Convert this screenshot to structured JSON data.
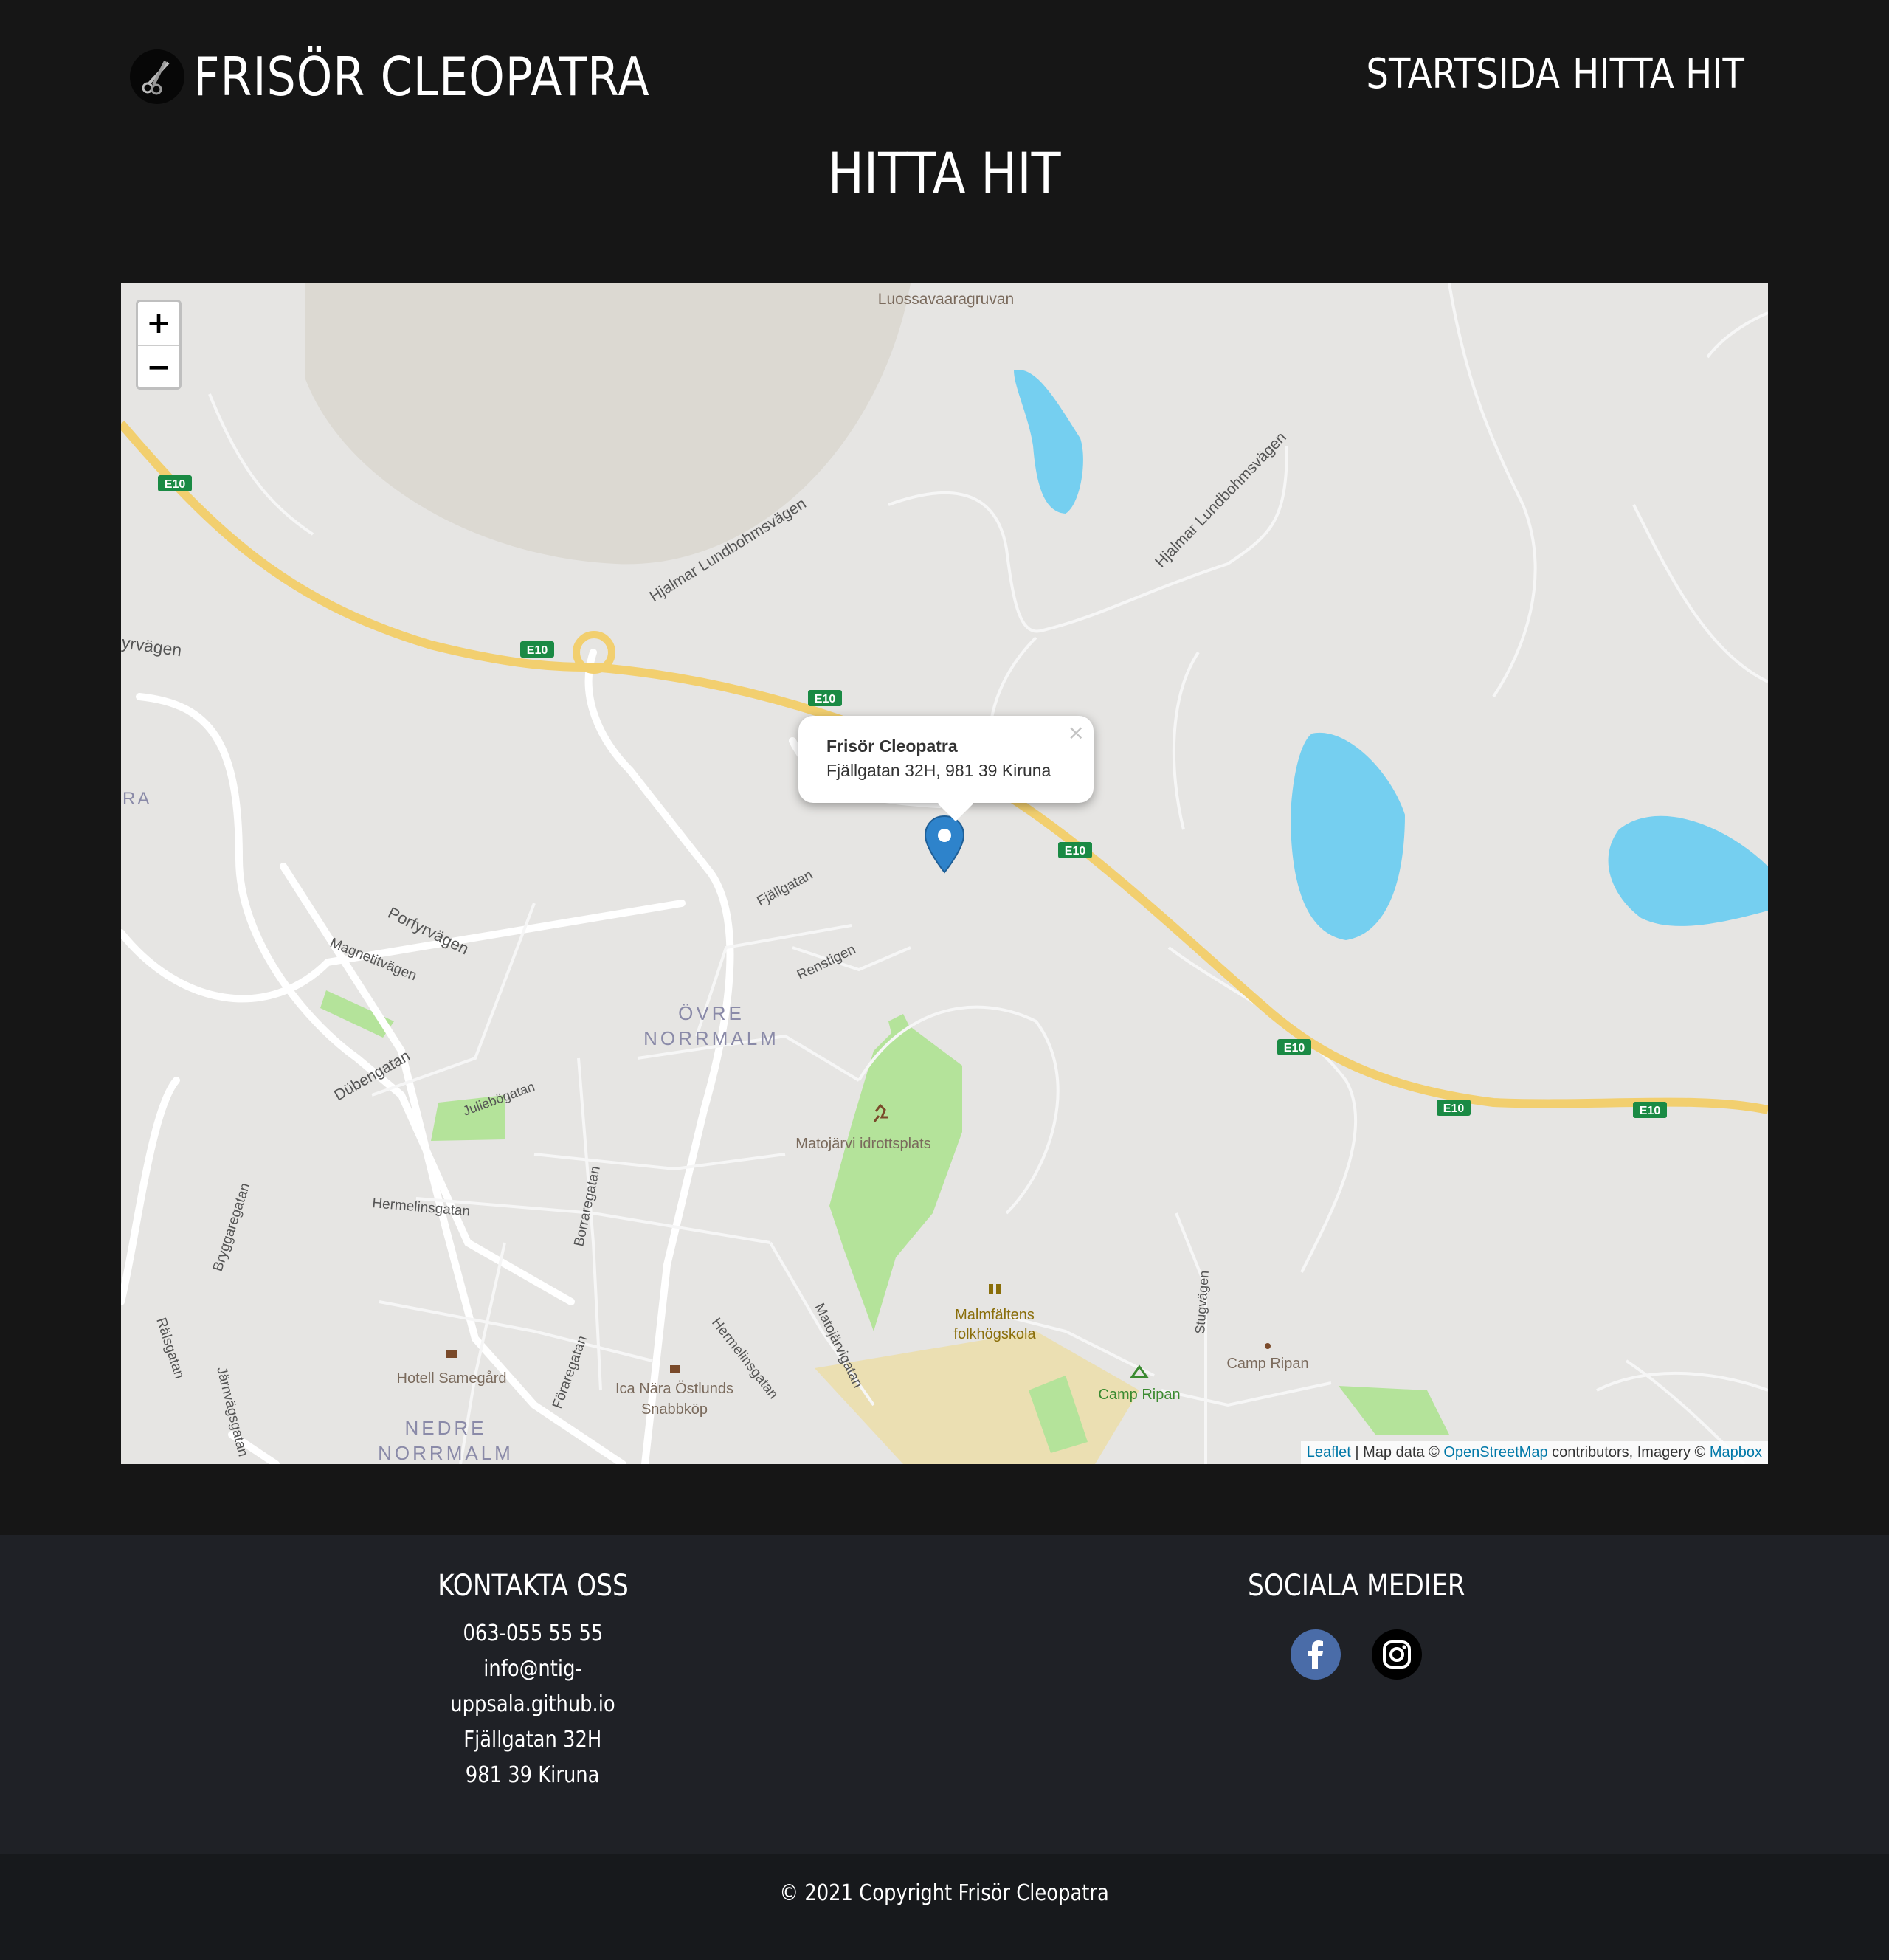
{
  "header": {
    "brand": "FRISÖR CLEOPATRA",
    "nav": [
      "STARTSIDA",
      "HITTA HIT"
    ]
  },
  "page_title": "HITTA HIT",
  "map": {
    "zoom_in": "+",
    "zoom_out": "−",
    "popup": {
      "title": "Frisör Cleopatra",
      "address": "Fjällgatan 32H, 981 39 Kiruna",
      "close": "×"
    },
    "labels": {
      "luossa": "Luossavaaragruvan",
      "hjalmar1": "Hjalmar Lundbohmsvägen",
      "hjalmar2": "Hjalmar Lundbohmsvägen",
      "e10": "E10",
      "yrvagen": "yrvägen",
      "ra": "RA",
      "porfyr": "Porfyrvägen",
      "magnetit": "Magnetitvägen",
      "fjallgatan": "Fjällgatan",
      "renstigen": "Renstigen",
      "ovre1": "ÖVRE",
      "ovre2": "NORRMALM",
      "dubengatan": "Dübengatan",
      "julieb": "Juliebögatan",
      "matojarvi": "Matojärvi idrottsplats",
      "hermelin1": "Hermelinsgatan",
      "borrare": "Borraregatan",
      "bryggare": "Bryggaregatan",
      "folkhog1": "Malmfältens",
      "folkhog2": "folkhögskola",
      "stugvagen": "Stugvägen",
      "campripan1": "Camp Ripan",
      "campripan2": "Camp Ripan",
      "hotell": "Hotell Samegård",
      "ica1": "Ica Nära Östlunds",
      "ica2": "Snabbköp",
      "hermelin2": "Hermelinsgatan",
      "matojarvig": "Matojärvigatan",
      "forare": "Föraregatan",
      "nedre1": "NEDRE",
      "nedre2": "NORRMALM",
      "rals": "Rälsgatan",
      "jarnvag": "Järnvägsgatan"
    },
    "attribution": {
      "leaflet": "Leaflet",
      "sep": " | Map data © ",
      "osm": "OpenStreetMap",
      "mid": " contributors, Imagery © ",
      "mapbox": "Mapbox"
    },
    "colors": {
      "land": "#e6e5e3",
      "water": "#75cff0",
      "park": "#b4e39a",
      "motorway": "#f2cf6f"
    }
  },
  "footer": {
    "contact": {
      "heading": "KONTAKTA OSS",
      "phone": "063-055 55 55",
      "email": "info@ntig-uppsala.github.io",
      "street": "Fjällgatan 32H",
      "city": "981 39 Kiruna"
    },
    "social": {
      "heading": "SOCIALA MEDIER",
      "icons": [
        "facebook-icon",
        "instagram-icon"
      ]
    }
  },
  "copyright": "© 2021 Copyright Frisör Cleopatra"
}
